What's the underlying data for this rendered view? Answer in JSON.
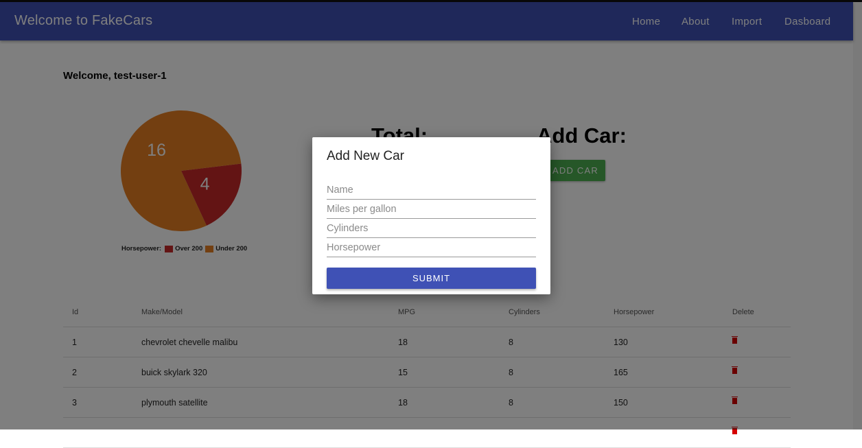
{
  "header": {
    "title": "Welcome to FakeCars",
    "nav": [
      "Home",
      "About",
      "Import",
      "Dasboard"
    ],
    "color": "#3f51b5"
  },
  "welcome": "Welcome, test-user-1",
  "chart_data": {
    "type": "pie",
    "legend_title": "Horsepower:",
    "slices": [
      {
        "label": "Over 200",
        "value": 4,
        "color": "#c62828"
      },
      {
        "label": "Under 200",
        "value": 16,
        "color": "#e67e22"
      }
    ]
  },
  "total_heading": "Total:",
  "add_heading": "Add Car:",
  "add_button": "ADD CAR",
  "table": {
    "columns": [
      "Id",
      "Make/Model",
      "MPG",
      "Cylinders",
      "Horsepower",
      "Delete"
    ],
    "rows": [
      [
        "1",
        "chevrolet chevelle malibu",
        "18",
        "8",
        "130"
      ],
      [
        "2",
        "buick skylark 320",
        "15",
        "8",
        "165"
      ],
      [
        "3",
        "plymouth satellite",
        "18",
        "8",
        "150"
      ]
    ]
  },
  "dialog": {
    "title": "Add New Car",
    "placeholders": [
      "Name",
      "Miles per gallon",
      "Cylinders",
      "Horsepower"
    ],
    "submit": "SUBMIT"
  }
}
